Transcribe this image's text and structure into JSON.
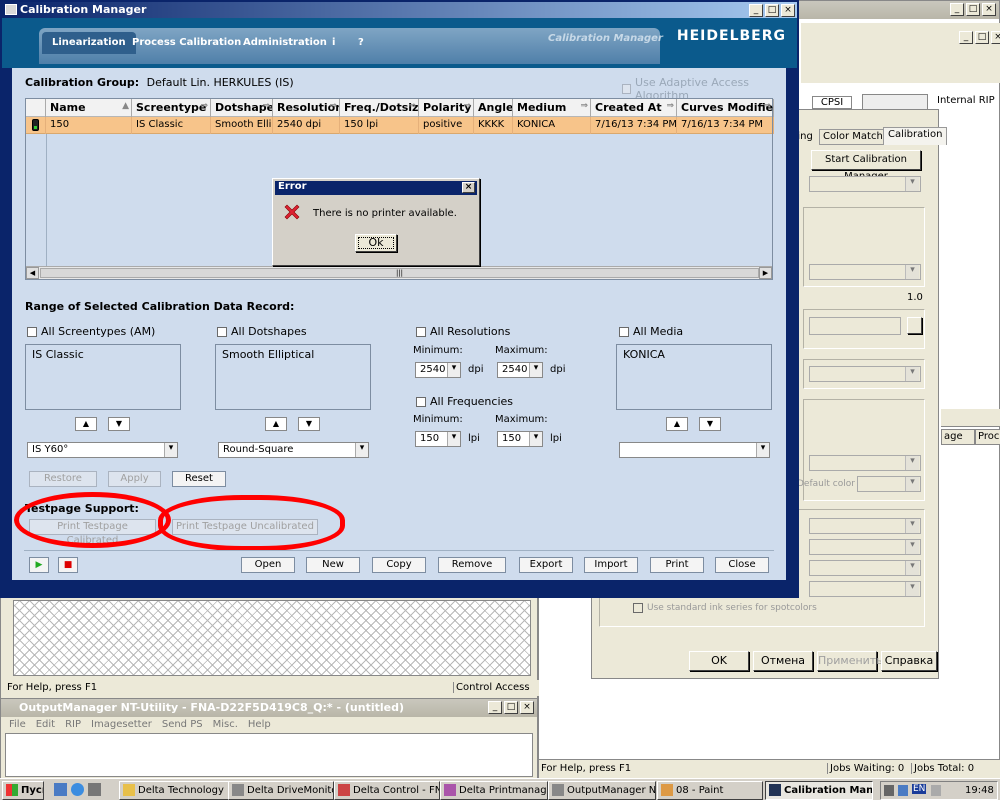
{
  "main_window": {
    "title": "Calibration Manager",
    "tabs": [
      "Linearization",
      "Process Calibration",
      "Administration",
      "i",
      "?"
    ],
    "watermark": "Calibration Manager",
    "brand": "HEIDELBERG",
    "calibration_group_label": "Calibration Group:",
    "calibration_group_value": "Default Lin. HERKULES (IS)",
    "adaptive_checkbox": "Use Adaptive Access Algorithm",
    "table": {
      "columns": [
        "Name",
        "Screentype",
        "Dotshape",
        "Resolution",
        "Freq./Dotsize",
        "Polarity",
        "Angles",
        "Medium",
        "Created At",
        "Curves Modified At"
      ],
      "row": [
        "150",
        "IS Classic",
        "Smooth Ellipt",
        "2540 dpi",
        "150 lpi",
        "positive",
        "KKKK",
        "KONICA",
        "7/16/13 7:34 PM",
        "7/16/13 7:34 PM"
      ]
    },
    "range_title": "Range of Selected Calibration Data Record:",
    "screentypes": {
      "check": "All Screentypes (AM)",
      "item": "IS Classic",
      "combo": "IS Y60°"
    },
    "dotshapes": {
      "check": "All Dotshapes",
      "item": "Smooth Elliptical",
      "combo": "Round-Square"
    },
    "resolutions": {
      "check": "All Resolutions",
      "min_label": "Minimum:",
      "max_label": "Maximum:",
      "min": "2540",
      "max": "2540",
      "unit": "dpi"
    },
    "frequencies": {
      "check": "All Frequencies",
      "min_label": "Minimum:",
      "max_label": "Maximum:",
      "min": "150",
      "max": "150",
      "unit": "lpi"
    },
    "media": {
      "check": "All Media",
      "item": "KONICA",
      "combo": ""
    },
    "buttons": {
      "restore": "Restore",
      "apply": "Apply",
      "reset": "Reset"
    },
    "testpage_title": "Testpage Support:",
    "print_calibrated": "Print Testpage Calibrated",
    "print_uncalibrated": "Print Testpage Uncalibrated",
    "bottom_buttons": [
      "Open",
      "New",
      "Copy",
      "Remove",
      "Export",
      "Import",
      "Print",
      "Close"
    ]
  },
  "dialog": {
    "title": "Error",
    "message": "There is no printer available.",
    "ok": "Ok"
  },
  "right_window": {
    "labels": {
      "cpsi": "CPSI",
      "internal_rip": "Internal RIP",
      "tab_partial": "ping",
      "tab_color": "Color Matching",
      "tab_calibration": "Calibration",
      "start_btn": "Start Calibration Manager",
      "version": "1.0",
      "default_color": "Default color",
      "use_standard": "Use standard ink series for spotcolors",
      "page": "age",
      "proc": "Proc"
    },
    "buttons": [
      "OK",
      "Отмена",
      "Применить",
      "Справка"
    ],
    "status": {
      "help": "For Help, press F1",
      "jobs_waiting": "Jobs Waiting: 0",
      "jobs_total": "Jobs Total: 0"
    }
  },
  "left_bg": {
    "status_help": "For Help, press F1",
    "status_access": "Control Access"
  },
  "output_manager": {
    "title": "OutputManager NT-Utility - FNA-D22F5D419C8_Q:* - (untitled)",
    "menu": [
      "File",
      "Edit",
      "RIP",
      "Imagesetter",
      "Send PS",
      "Misc.",
      "Help"
    ]
  },
  "taskbar": {
    "start": "Пуск",
    "items": [
      "Delta Technology",
      "Delta DriveMonitor",
      "Delta Control - FNA-...",
      "Delta Printmanager -...",
      "OutputManager NT-...",
      "08 - Paint",
      "Calibration Manag..."
    ],
    "lang": "EN",
    "time": "19:48"
  },
  "colors": {
    "accent": "#0a246a",
    "panel": "#cfdced",
    "selected_row": "#f7c48a",
    "annotation": "#ff0000"
  }
}
